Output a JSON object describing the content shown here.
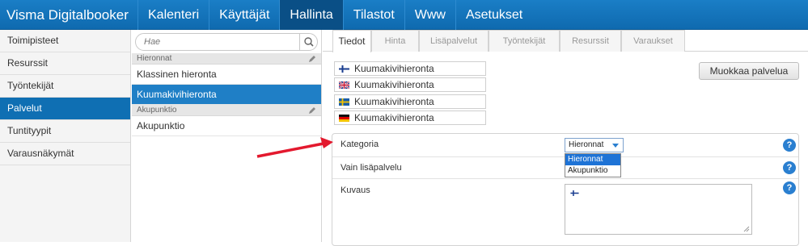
{
  "app": {
    "title": "Visma Digitalbooker"
  },
  "nav": {
    "items": [
      {
        "label": "Kalenteri",
        "active": false
      },
      {
        "label": "Käyttäjät",
        "active": false
      },
      {
        "label": "Hallinta",
        "active": true
      },
      {
        "label": "Tilastot",
        "active": false
      },
      {
        "label": "Www",
        "active": false
      },
      {
        "label": "Asetukset",
        "active": false
      }
    ]
  },
  "sidebar": {
    "items": [
      {
        "label": "Toimipisteet"
      },
      {
        "label": "Resurssit"
      },
      {
        "label": "Työntekijät"
      },
      {
        "label": "Palvelut",
        "active": true
      },
      {
        "label": "Tuntityypit"
      },
      {
        "label": "Varausnäkymät"
      }
    ]
  },
  "list": {
    "search_placeholder": "Hae",
    "groups": [
      {
        "title": "Hieronnat",
        "items": [
          "Klassinen hieronta",
          "Kuumakivihieronta"
        ]
      },
      {
        "title": "Akupunktio",
        "items": [
          "Akupunktio"
        ]
      }
    ],
    "selected": "Kuumakivihieronta"
  },
  "tabs": [
    {
      "label": "Tiedot",
      "active": true
    },
    {
      "label": "Hinta"
    },
    {
      "label": "Lisäpalvelut"
    },
    {
      "label": "Työntekijät"
    },
    {
      "label": "Resurssit"
    },
    {
      "label": "Varaukset"
    }
  ],
  "names": [
    {
      "lang": "fi",
      "value": "Kuumakivihieronta"
    },
    {
      "lang": "en",
      "value": "Kuumakivihieronta"
    },
    {
      "lang": "sv",
      "value": "Kuumakivihieronta"
    },
    {
      "lang": "de",
      "value": "Kuumakivihieronta"
    }
  ],
  "edit_button": "Muokkaa palvelua",
  "form": {
    "category_label": "Kategoria",
    "category_value": "Hieronnat",
    "category_options": [
      "Hieronnat",
      "Akupunktio"
    ],
    "addon_label": "Vain lisäpalvelu",
    "description_label": "Kuvaus",
    "help_glyph": "?"
  },
  "colors": {
    "topbar": "#1a7ec6",
    "active_nav": "#0a4f86",
    "accent": "#1f7fc6",
    "arrow": "#e3192e"
  }
}
